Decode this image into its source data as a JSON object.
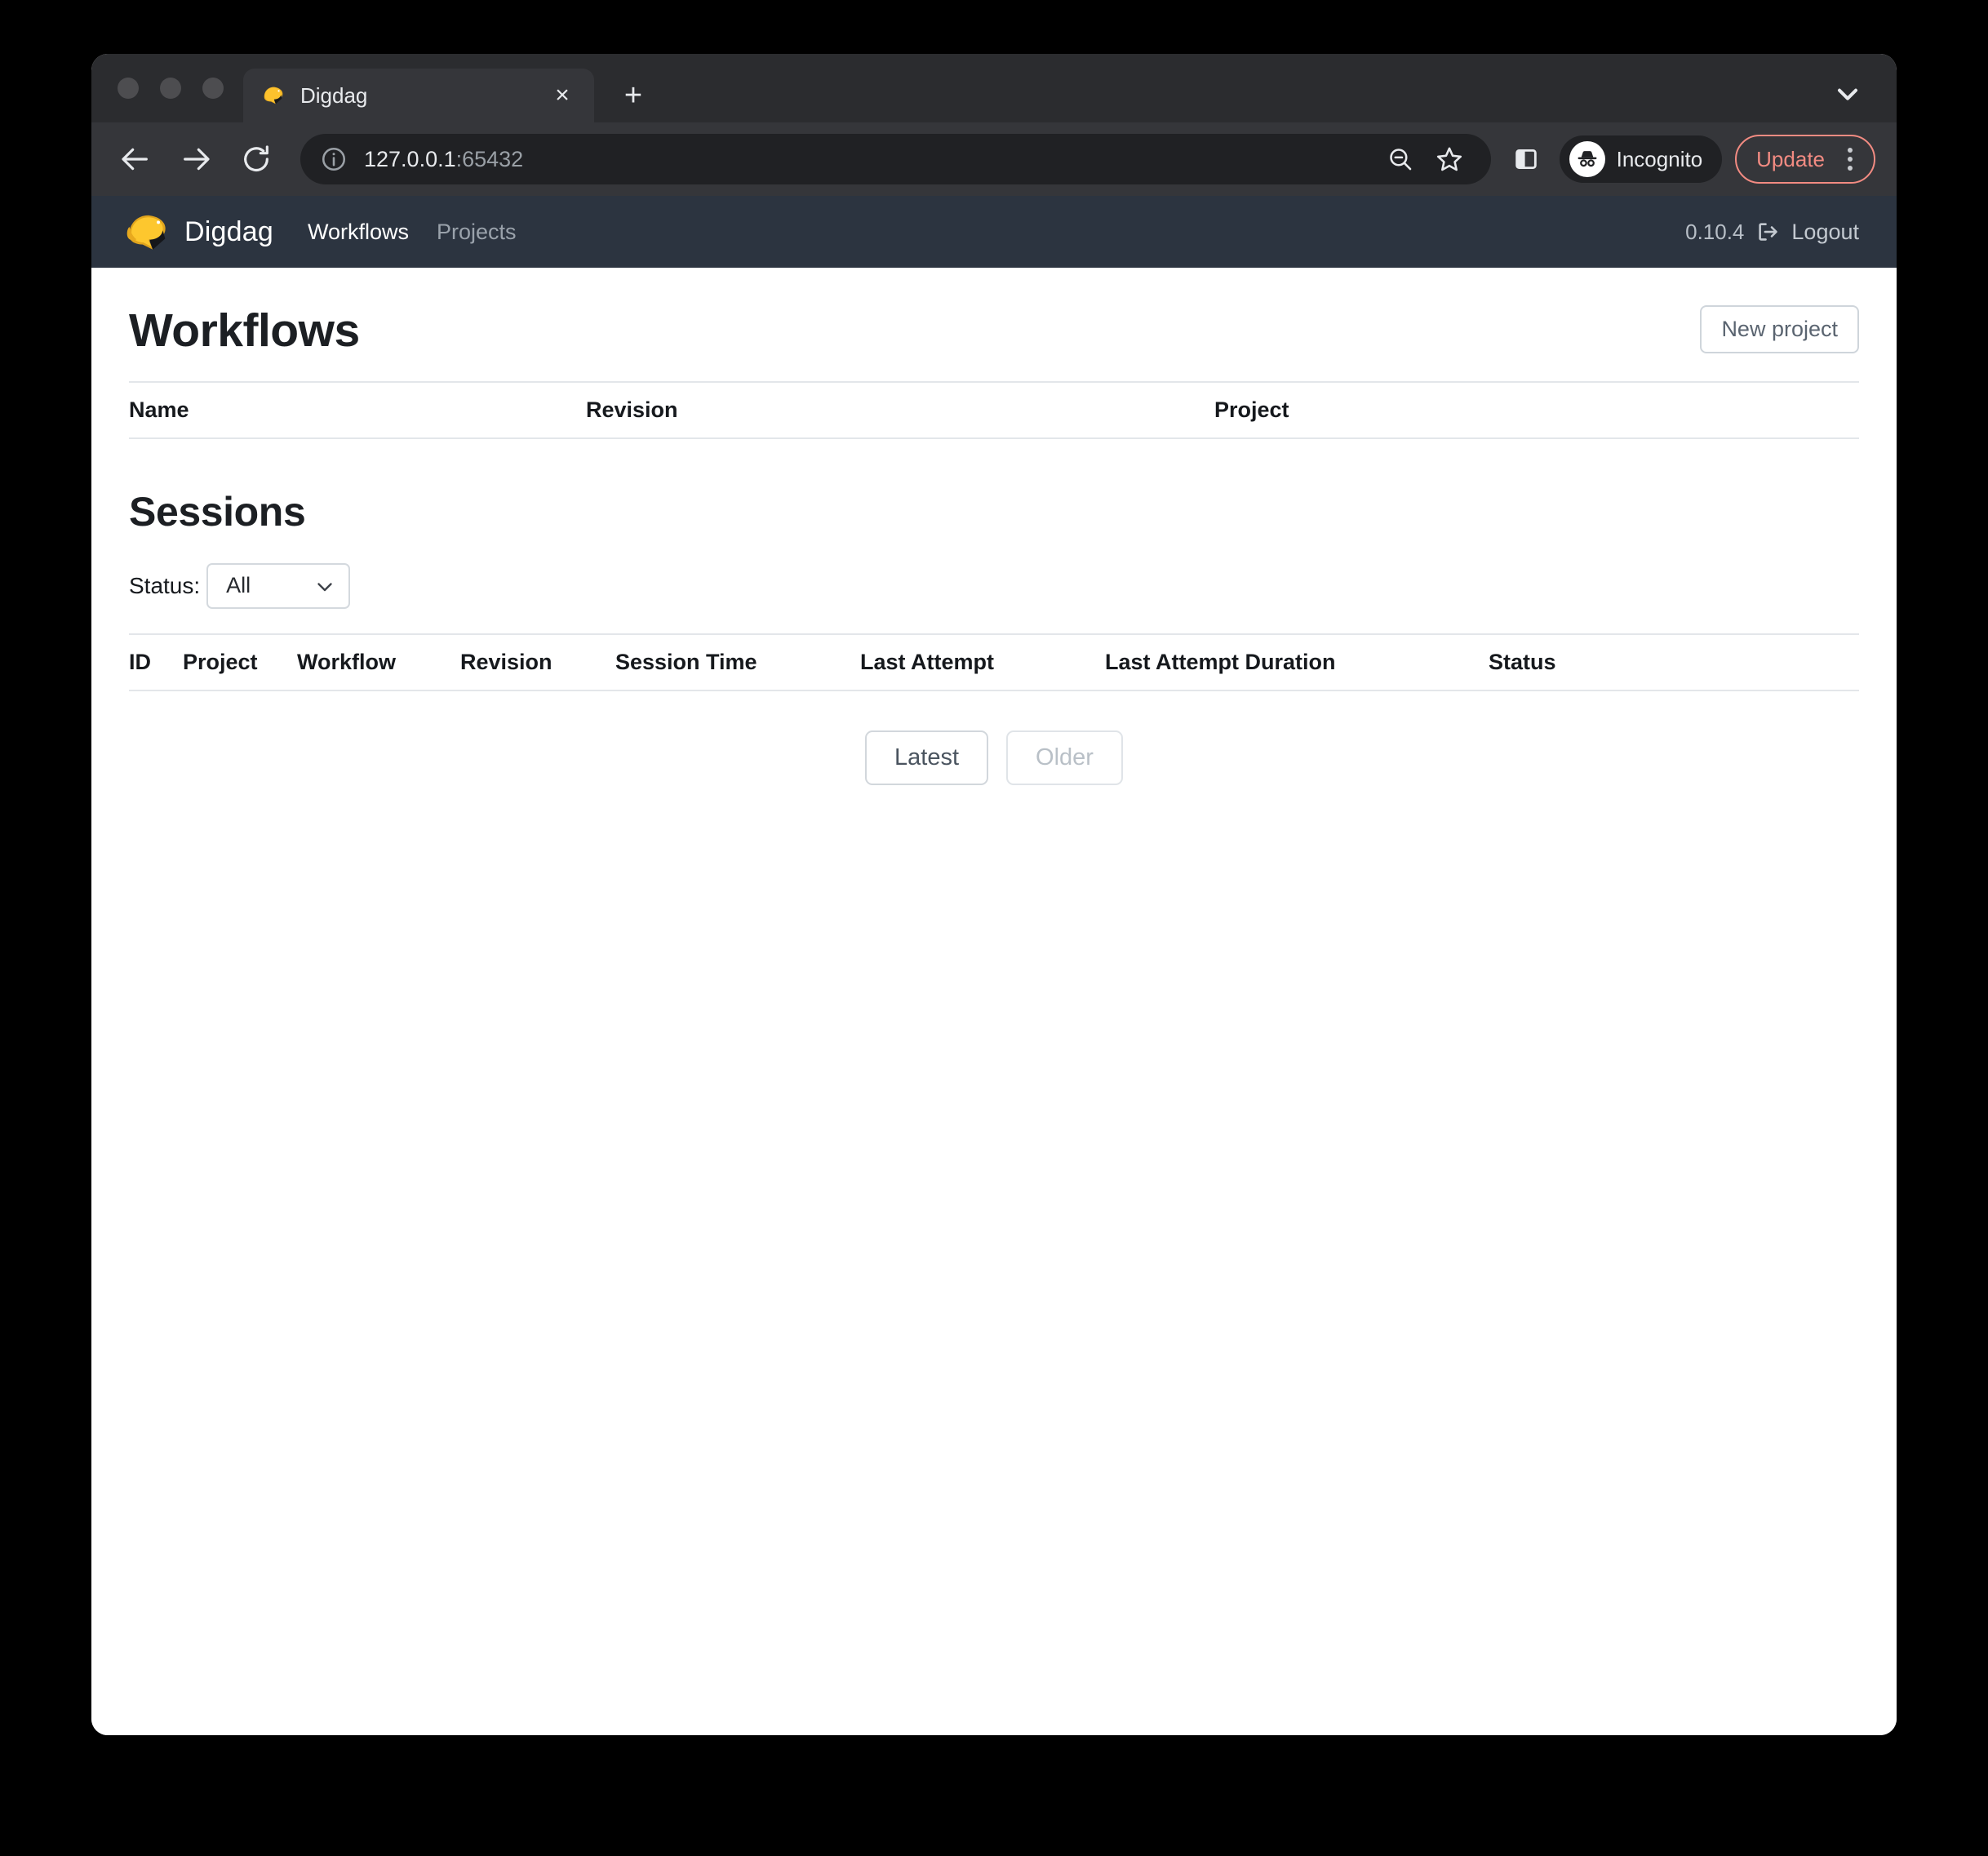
{
  "browser": {
    "tab": {
      "title": "Digdag",
      "favicon": "digdag-fox-icon",
      "close_label": "×"
    },
    "new_tab_label": "+",
    "tab_search_icon": "chevron-down-icon",
    "back_icon": "arrow-left-icon",
    "forward_icon": "arrow-right-icon",
    "reload_icon": "reload-icon",
    "site_info_icon": "info-circle-icon",
    "url": {
      "host": "127.0.0.1",
      "port": ":65432",
      "full": "127.0.0.1:65432"
    },
    "zoom_icon": "zoom-out-icon",
    "bookmark_icon": "star-icon",
    "side_panel_icon": "side-panel-icon",
    "profile": {
      "label": "Incognito",
      "icon": "incognito-icon"
    },
    "update": {
      "label": "Update",
      "accent": "#f28b82"
    },
    "menu_icon": "kebab-menu-icon",
    "traffic_lights": [
      "close",
      "minimize",
      "maximize"
    ]
  },
  "app": {
    "brand": "Digdag",
    "logo_icon": "digdag-fox-logo",
    "nav": [
      {
        "label": "Workflows",
        "active": true
      },
      {
        "label": "Projects",
        "active": false
      }
    ],
    "version": "0.10.4",
    "logout_label": "Logout",
    "logout_icon": "sign-out-icon",
    "navbar_color": "#2c3440"
  },
  "workflows": {
    "title": "Workflows",
    "new_project_label": "New project",
    "columns": [
      "Name",
      "Revision",
      "Project"
    ],
    "rows": []
  },
  "sessions": {
    "title": "Sessions",
    "status_label": "Status:",
    "status_value": "All",
    "status_options": [
      "All"
    ],
    "columns": [
      "ID",
      "Project",
      "Workflow",
      "Revision",
      "Session Time",
      "Last Attempt",
      "Last Attempt Duration",
      "Status"
    ],
    "rows": [],
    "pager": {
      "latest_label": "Latest",
      "older_label": "Older",
      "older_disabled": true
    }
  }
}
